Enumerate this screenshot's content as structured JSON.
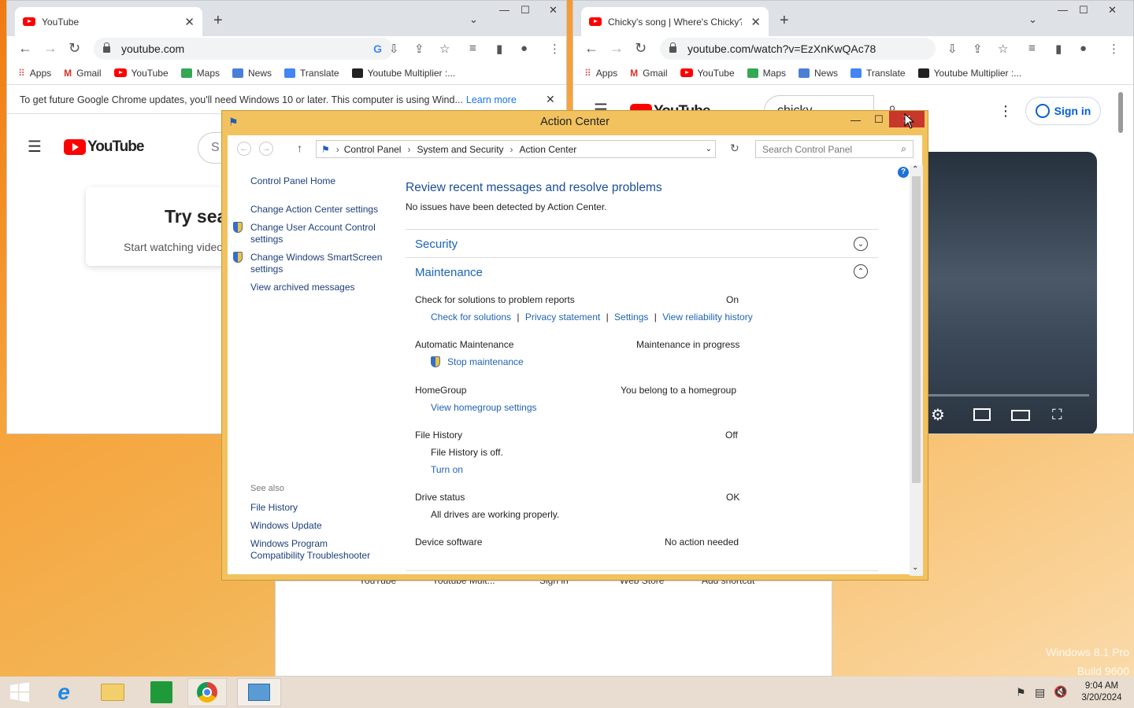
{
  "left_chrome": {
    "tab_title": "YouTube",
    "url": "youtube.com",
    "bookmarks": [
      "Apps",
      "Gmail",
      "YouTube",
      "Maps",
      "News",
      "Translate",
      "Youtube Multiplier :..."
    ],
    "info_text": "To get future Google Chrome updates, you'll need Windows 10 or later. This computer is using Wind...",
    "info_link": "Learn more",
    "yt_logo": "YouTube",
    "search_partial": "S",
    "heading_partial": "Try sea",
    "subtext_partial": "Start watching video"
  },
  "right_chrome": {
    "tab_title": "Chicky's song | Where's Chicky? |",
    "url": "youtube.com/watch?v=EzXnKwQAc78",
    "bookmarks": [
      "Apps",
      "Gmail",
      "YouTube",
      "Maps",
      "News",
      "Translate",
      "Youtube Multiplier :..."
    ],
    "search_text": "chicky",
    "yt_logo": "YouTube",
    "signin": "Sign in"
  },
  "behind_window": {
    "shortcuts": [
      "YouTube",
      "Youtube Mult...",
      "Sign in",
      "Web Store",
      "Add shortcut"
    ]
  },
  "action_center": {
    "title": "Action Center",
    "breadcrumb": [
      "Control Panel",
      "System and Security",
      "Action Center"
    ],
    "search_placeholder": "Search Control Panel",
    "sidebar": {
      "home": "Control Panel Home",
      "links": [
        "Change Action Center settings",
        "Change User Account Control settings",
        "Change Windows SmartScreen settings",
        "View archived messages"
      ],
      "see_also_label": "See also",
      "see_also": [
        "File History",
        "Windows Update",
        "Windows Program Compatibility Troubleshooter"
      ]
    },
    "heading": "Review recent messages and resolve problems",
    "subheading": "No issues have been detected by Action Center.",
    "security_label": "Security",
    "maintenance_label": "Maintenance",
    "items": {
      "problem_reports": {
        "label": "Check for solutions to problem reports",
        "status": "On",
        "links": [
          "Check for solutions",
          "Privacy statement",
          "Settings",
          "View reliability history"
        ]
      },
      "auto_maint": {
        "label": "Automatic Maintenance",
        "status": "Maintenance in progress",
        "link": "Stop maintenance"
      },
      "homegroup": {
        "label": "HomeGroup",
        "status": "You belong to a homegroup",
        "link": "View homegroup settings"
      },
      "file_history": {
        "label": "File History",
        "status": "Off",
        "detail": "File History is off.",
        "link": "Turn on"
      },
      "drive": {
        "label": "Drive status",
        "status": "OK",
        "detail": "All drives are working properly."
      },
      "device": {
        "label": "Device software",
        "status": "No action needed"
      }
    }
  },
  "desktop": {
    "watermark_line1": "Windows 8.1 Pro",
    "watermark_line2": "Build 9600"
  },
  "taskbar": {
    "time": "9:04 AM",
    "date": "3/20/2024"
  }
}
